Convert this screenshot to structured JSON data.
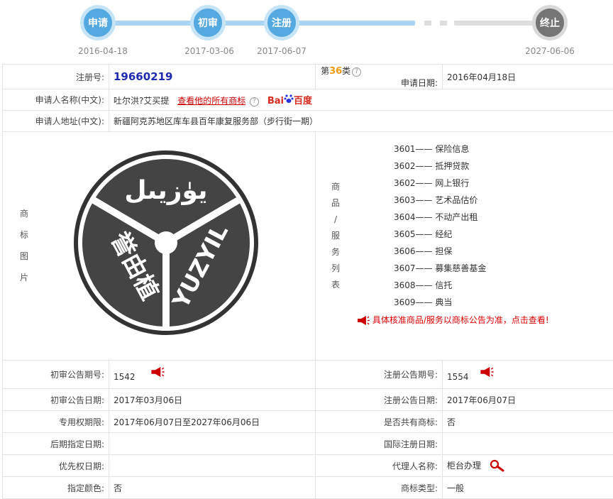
{
  "timeline": {
    "nodes": [
      {
        "label": "申请",
        "date": "2016-04-18"
      },
      {
        "label": "初审",
        "date": "2017-03-06"
      },
      {
        "label": "注册",
        "date": "2017-06-07"
      },
      {
        "label": "终止",
        "date": "2027-06-06"
      }
    ]
  },
  "labels": {
    "reg_no": "注册号:",
    "class_prefix": "第",
    "class_suffix": "类",
    "apply_date": "申请日期:",
    "applicant": "申请人名称(中文):",
    "address": "申请人地址(中文):",
    "image": [
      "商",
      "标",
      "图",
      "片"
    ],
    "services": [
      "商",
      "品",
      "/",
      "服",
      "务",
      "列",
      "表"
    ],
    "prelim_no": "初审公告期号:",
    "reg_notice_no": "注册公告期号:",
    "prelim_date": "初审公告日期:",
    "reg_notice_date": "注册公告日期:",
    "exclusive_period": "专用权期限:",
    "shared": "是否共有商标:",
    "later_date": "后期指定日期:",
    "intl_date": "国际注册日期:",
    "priority_date": "优先权日期:",
    "agent": "代理人名称:",
    "color": "指定颜色:",
    "type": "商标类型:"
  },
  "record": {
    "reg_no": "19660219",
    "class_num": "36",
    "apply_date": "2016年04月18日",
    "applicant": "吐尔洪?艾买提",
    "all_marks_link": "查看他的所有商标",
    "baidu_bai": "Bai",
    "baidu_du": "百度",
    "address": "新疆阿克苏地区库车县百年康复服务部（步行街一期）",
    "prelim_no": "1542",
    "reg_notice_no": "1554",
    "prelim_date": "2017年03月06日",
    "reg_notice_date": "2017年06月07日",
    "exclusive_period": "2017年06月07日至2027年06月06日",
    "shared": "否",
    "later_date": "",
    "intl_date": "",
    "priority_date": "",
    "agent": "柜台办理",
    "color": "否",
    "type": "一般"
  },
  "logo": {
    "uyghur_text": "يۈزيىل",
    "chinese_text": "誉由植",
    "latin_text": "YUZYIL"
  },
  "services": [
    {
      "code": "3601",
      "name": "保险信息"
    },
    {
      "code": "3602",
      "name": "抵押贷款"
    },
    {
      "code": "3602",
      "name": "网上银行"
    },
    {
      "code": "3603",
      "name": "艺术品估价"
    },
    {
      "code": "3604",
      "name": "不动产出租"
    },
    {
      "code": "3605",
      "name": "经纪"
    },
    {
      "code": "3606",
      "name": "担保"
    },
    {
      "code": "3607",
      "name": "募集慈善基金"
    },
    {
      "code": "3608",
      "name": "信托"
    },
    {
      "code": "3609",
      "name": "典当"
    }
  ],
  "services_notice": "具体核准商品/服务以商标公告为准，点击查看!",
  "colors": {
    "accent_blue": "#55a9e1",
    "red": "#c00000",
    "grey": "#757575"
  }
}
